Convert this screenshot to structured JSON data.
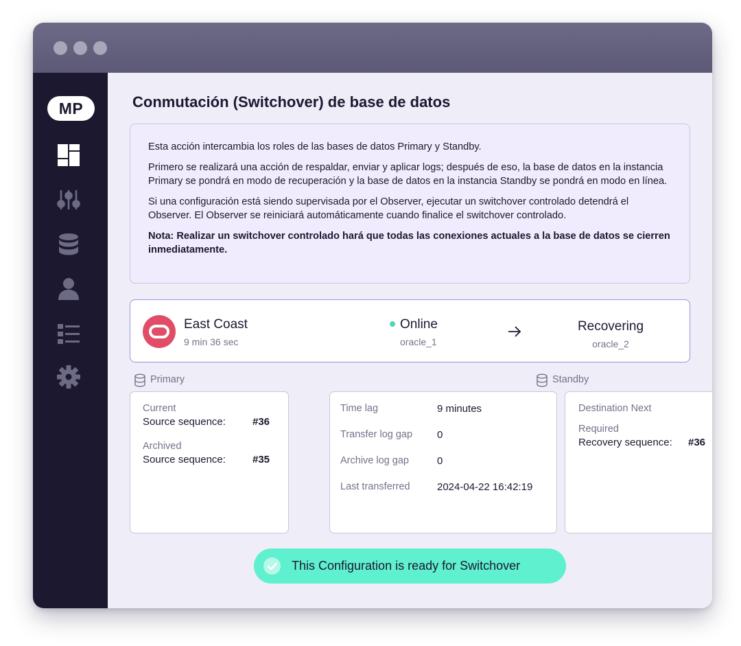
{
  "sidebar": {
    "logo": "MP",
    "items": [
      {
        "icon": "dashboard-icon"
      },
      {
        "icon": "sliders-icon"
      },
      {
        "icon": "database-icon"
      },
      {
        "icon": "user-icon"
      },
      {
        "icon": "list-icon"
      },
      {
        "icon": "gear-icon"
      }
    ]
  },
  "page": {
    "title": "Conmutación (Switchover) de base de datos"
  },
  "info": {
    "p1": "Esta acción intercambia los roles de las bases de datos Primary y Standby.",
    "p2": "Primero se realizará una acción de respaldar, enviar y aplicar logs; después de eso, la base de datos en la instancia Primary se pondrá en modo de recuperación y la base de datos en la instancia Standby se pondrá en modo en línea.",
    "p3": "Si una configuración está siendo supervisada por el Observer, ejecutar un switchover controlado detendrá el Observer. El Observer se reiniciará automáticamente cuando finalice el switchover controlado.",
    "note": "Nota: Realizar un switchover controlado hará que todas las conexiones actuales a la base de datos se cierren inmediatamente."
  },
  "status": {
    "site_name": "East Coast",
    "elapsed": "9 min 36 sec",
    "online_label": "Online",
    "online_host": "oracle_1",
    "recovering_label": "Recovering",
    "recovering_host": "oracle_2",
    "online_color": "#4fd6b6",
    "logo_color": "#e14d66"
  },
  "sections": {
    "primary": "Primary",
    "standby": "Standby"
  },
  "primary_card": {
    "current_label": "Current",
    "current_key": "Source sequence:",
    "current_value": "#36",
    "archived_label": "Archived",
    "archived_key": "Source sequence:",
    "archived_value": "#35"
  },
  "metrics": [
    {
      "label": "Time lag",
      "value": "9 minutes"
    },
    {
      "label": "Transfer log gap",
      "value": "0"
    },
    {
      "label": "Archive log gap",
      "value": "0"
    },
    {
      "label": "Last transferred",
      "value": "2024-04-22 16:42:19"
    }
  ],
  "standby_card": {
    "destination_label": "Destination Next",
    "required_label": "Required",
    "recovery_key": "Recovery sequence:",
    "recovery_value": "#36"
  },
  "ready": {
    "text": "This Configuration is ready for Switchover",
    "color": "#5ff0cf"
  }
}
